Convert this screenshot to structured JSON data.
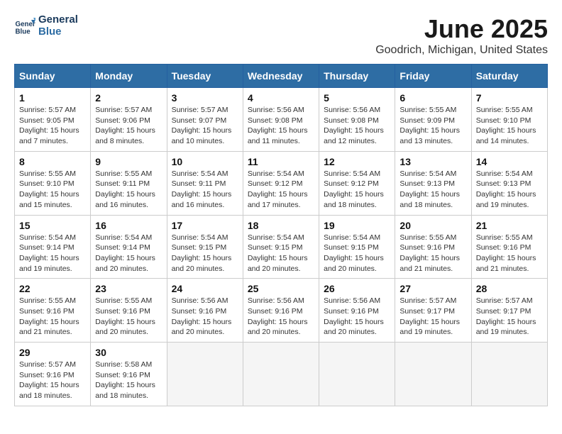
{
  "header": {
    "logo_line1": "General",
    "logo_line2": "Blue",
    "title": "June 2025",
    "subtitle": "Goodrich, Michigan, United States"
  },
  "columns": [
    "Sunday",
    "Monday",
    "Tuesday",
    "Wednesday",
    "Thursday",
    "Friday",
    "Saturday"
  ],
  "weeks": [
    [
      {
        "day": "1",
        "sunrise": "5:57 AM",
        "sunset": "9:05 PM",
        "daylight": "15 hours and 7 minutes."
      },
      {
        "day": "2",
        "sunrise": "5:57 AM",
        "sunset": "9:06 PM",
        "daylight": "15 hours and 8 minutes."
      },
      {
        "day": "3",
        "sunrise": "5:57 AM",
        "sunset": "9:07 PM",
        "daylight": "15 hours and 10 minutes."
      },
      {
        "day": "4",
        "sunrise": "5:56 AM",
        "sunset": "9:08 PM",
        "daylight": "15 hours and 11 minutes."
      },
      {
        "day": "5",
        "sunrise": "5:56 AM",
        "sunset": "9:08 PM",
        "daylight": "15 hours and 12 minutes."
      },
      {
        "day": "6",
        "sunrise": "5:55 AM",
        "sunset": "9:09 PM",
        "daylight": "15 hours and 13 minutes."
      },
      {
        "day": "7",
        "sunrise": "5:55 AM",
        "sunset": "9:10 PM",
        "daylight": "15 hours and 14 minutes."
      }
    ],
    [
      {
        "day": "8",
        "sunrise": "5:55 AM",
        "sunset": "9:10 PM",
        "daylight": "15 hours and 15 minutes."
      },
      {
        "day": "9",
        "sunrise": "5:55 AM",
        "sunset": "9:11 PM",
        "daylight": "15 hours and 16 minutes."
      },
      {
        "day": "10",
        "sunrise": "5:54 AM",
        "sunset": "9:11 PM",
        "daylight": "15 hours and 16 minutes."
      },
      {
        "day": "11",
        "sunrise": "5:54 AM",
        "sunset": "9:12 PM",
        "daylight": "15 hours and 17 minutes."
      },
      {
        "day": "12",
        "sunrise": "5:54 AM",
        "sunset": "9:12 PM",
        "daylight": "15 hours and 18 minutes."
      },
      {
        "day": "13",
        "sunrise": "5:54 AM",
        "sunset": "9:13 PM",
        "daylight": "15 hours and 18 minutes."
      },
      {
        "day": "14",
        "sunrise": "5:54 AM",
        "sunset": "9:13 PM",
        "daylight": "15 hours and 19 minutes."
      }
    ],
    [
      {
        "day": "15",
        "sunrise": "5:54 AM",
        "sunset": "9:14 PM",
        "daylight": "15 hours and 19 minutes."
      },
      {
        "day": "16",
        "sunrise": "5:54 AM",
        "sunset": "9:14 PM",
        "daylight": "15 hours and 20 minutes."
      },
      {
        "day": "17",
        "sunrise": "5:54 AM",
        "sunset": "9:15 PM",
        "daylight": "15 hours and 20 minutes."
      },
      {
        "day": "18",
        "sunrise": "5:54 AM",
        "sunset": "9:15 PM",
        "daylight": "15 hours and 20 minutes."
      },
      {
        "day": "19",
        "sunrise": "5:54 AM",
        "sunset": "9:15 PM",
        "daylight": "15 hours and 20 minutes."
      },
      {
        "day": "20",
        "sunrise": "5:55 AM",
        "sunset": "9:16 PM",
        "daylight": "15 hours and 21 minutes."
      },
      {
        "day": "21",
        "sunrise": "5:55 AM",
        "sunset": "9:16 PM",
        "daylight": "15 hours and 21 minutes."
      }
    ],
    [
      {
        "day": "22",
        "sunrise": "5:55 AM",
        "sunset": "9:16 PM",
        "daylight": "15 hours and 21 minutes."
      },
      {
        "day": "23",
        "sunrise": "5:55 AM",
        "sunset": "9:16 PM",
        "daylight": "15 hours and 20 minutes."
      },
      {
        "day": "24",
        "sunrise": "5:56 AM",
        "sunset": "9:16 PM",
        "daylight": "15 hours and 20 minutes."
      },
      {
        "day": "25",
        "sunrise": "5:56 AM",
        "sunset": "9:16 PM",
        "daylight": "15 hours and 20 minutes."
      },
      {
        "day": "26",
        "sunrise": "5:56 AM",
        "sunset": "9:16 PM",
        "daylight": "15 hours and 20 minutes."
      },
      {
        "day": "27",
        "sunrise": "5:57 AM",
        "sunset": "9:17 PM",
        "daylight": "15 hours and 19 minutes."
      },
      {
        "day": "28",
        "sunrise": "5:57 AM",
        "sunset": "9:17 PM",
        "daylight": "15 hours and 19 minutes."
      }
    ],
    [
      {
        "day": "29",
        "sunrise": "5:57 AM",
        "sunset": "9:16 PM",
        "daylight": "15 hours and 18 minutes."
      },
      {
        "day": "30",
        "sunrise": "5:58 AM",
        "sunset": "9:16 PM",
        "daylight": "15 hours and 18 minutes."
      },
      null,
      null,
      null,
      null,
      null
    ]
  ],
  "labels": {
    "sunrise": "Sunrise:",
    "sunset": "Sunset:",
    "daylight": "Daylight:"
  }
}
